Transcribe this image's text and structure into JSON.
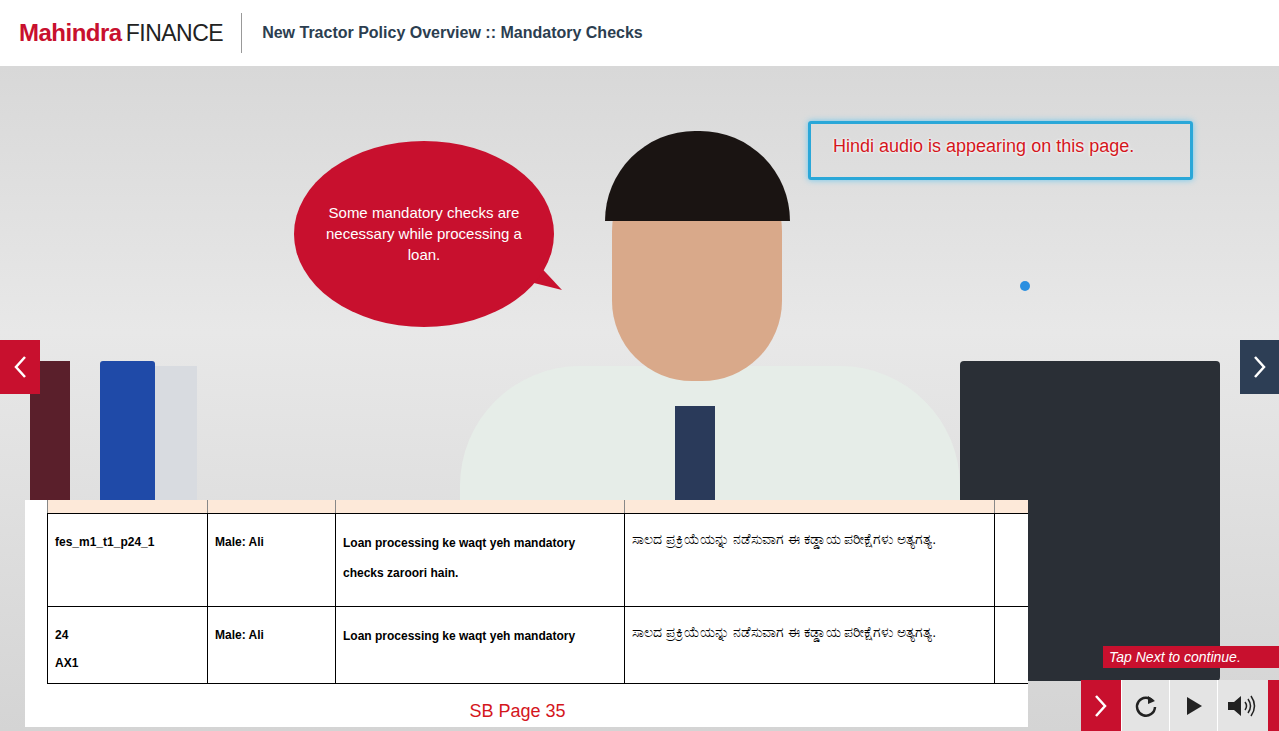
{
  "header": {
    "logo": {
      "brand": "Mahindra",
      "suffix": "FINANCE"
    },
    "title": "New Tractor Policy Overview :: Mandatory Checks"
  },
  "speech_bubble": "Some mandatory checks are necessary while processing a loan.",
  "annotation": "Hindi audio is appearing on this page.",
  "table": {
    "rows": [
      [
        "fes_m1_t1_p24_1",
        "Male: Ali",
        "Loan processing ke waqt yeh mandatory checks zaroori hain.",
        "ಸಾಲದ ಪ್ರಕ್ರಿಯೆಯನ್ನು ನಡೆಸುವಾಗ ಈ ಕಡ್ಡಾಯ ಪರೀಕ್ಷೆಗಳು ಅತ್ಯಗತ್ಯ."
      ],
      [
        "24\nAX1",
        "Male: Ali",
        "Loan processing ke waqt yeh mandatory",
        "ಸಾಲದ ಪ್ರಕ್ರಿಯೆಯನ್ನು ನಡೆಸುವಾಗ ಈ ಕಡ್ಡಾಯ ಪರೀಕ್ಷೆಗಳು ಅತ್ಯಗತ್ಯ."
      ]
    ]
  },
  "page_label": "SB Page 35",
  "hint": "Tap Next to continue."
}
